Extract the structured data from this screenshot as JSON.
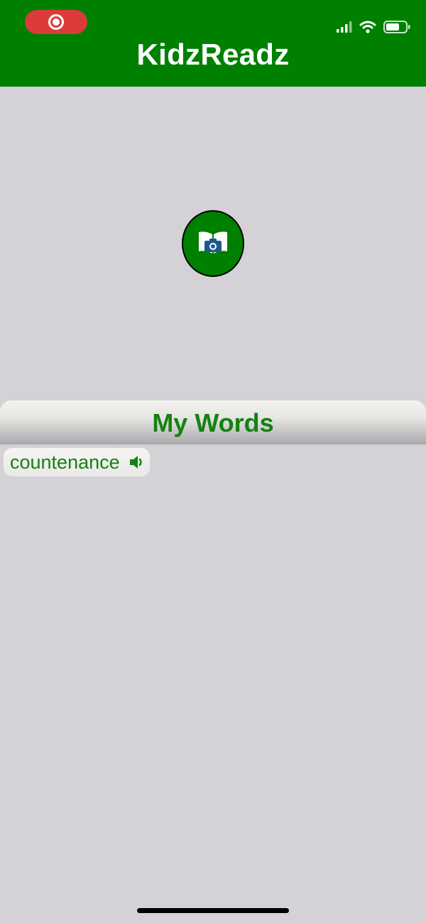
{
  "app": {
    "title": "KidzReadz"
  },
  "status_bar": {
    "record_icon": "screen-record-icon",
    "icons": [
      "signal-icon",
      "wifi-icon",
      "battery-icon"
    ]
  },
  "main": {
    "scan_button_icon": "book-camera-icon"
  },
  "my_words": {
    "title": "My Words",
    "items": [
      {
        "word": "countenance",
        "icon": "speaker-icon"
      }
    ]
  },
  "colors": {
    "header_green": "#008000",
    "text_green": "#138213",
    "background": "#d4d2d6",
    "record_red": "#dc3b3b",
    "icon_blue": "#1d5a8c"
  }
}
